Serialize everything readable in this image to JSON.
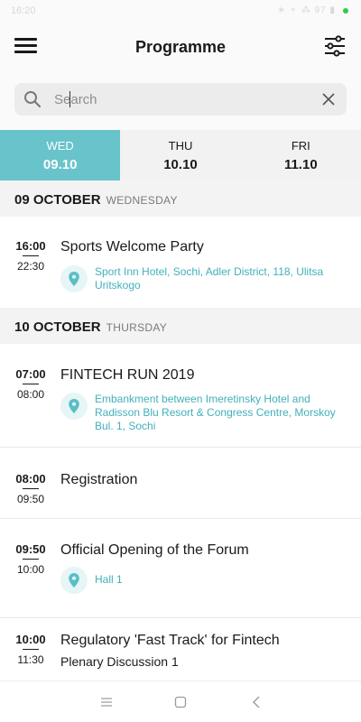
{
  "status": {
    "time": "16:20",
    "indicators": "∗ ⚬ ⁂ 97 ▮"
  },
  "header": {
    "title": "Programme",
    "menu_icon": "hamburger-icon",
    "filter_icon": "sliders-icon"
  },
  "search": {
    "placeholder": "Search",
    "value": ""
  },
  "tabs": [
    {
      "dow": "WED",
      "date": "09.10",
      "active": true
    },
    {
      "dow": "THU",
      "date": "10.10",
      "active": false
    },
    {
      "dow": "FRI",
      "date": "11.10",
      "active": false
    }
  ],
  "days": [
    {
      "date": "09 OCTOBER",
      "weekday": "WEDNESDAY",
      "events": [
        {
          "start": "16:00",
          "end": "22:30",
          "title": "Sports Welcome Party",
          "location": "Sport Inn Hotel, Sochi, Adler District, 118, Ulitsa Uritskogo"
        }
      ]
    },
    {
      "date": "10 OCTOBER",
      "weekday": "THURSDAY",
      "events": [
        {
          "start": "07:00",
          "end": "08:00",
          "title": "FINTECH RUN 2019",
          "location": "Embankment between Imeretinsky Hotel and Radisson Blu Resort & Congress Centre, Morskoy Bul. 1, Sochi"
        },
        {
          "start": "08:00",
          "end": "09:50",
          "title": "Registration"
        },
        {
          "start": "09:50",
          "end": "10:00",
          "title": "Official Opening of the Forum",
          "location": "Hall 1"
        },
        {
          "start": "10:00",
          "end": "11:30",
          "title": "Regulatory 'Fast Track' for Fintech",
          "subtitle": "Plenary Discussion 1"
        }
      ]
    }
  ],
  "colors": {
    "accent": "#69c3cb",
    "location_text": "#41b0ba",
    "pin_bg": "#e6f5f6"
  }
}
